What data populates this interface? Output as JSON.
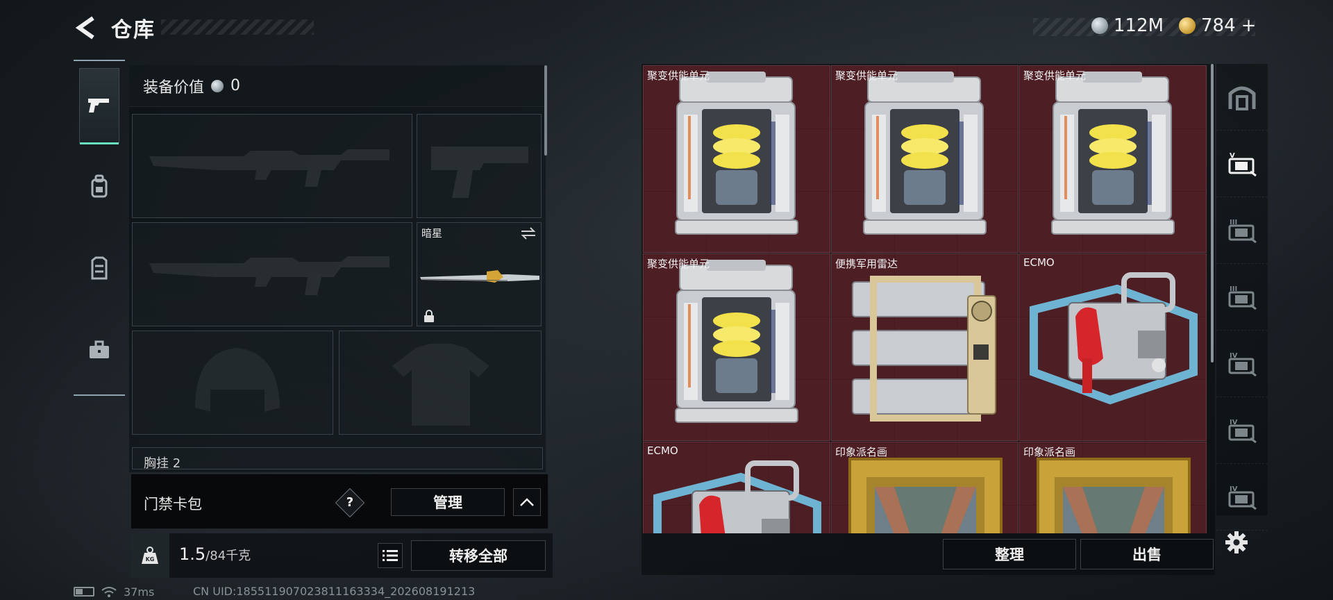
{
  "header": {
    "title": "仓库",
    "currency_silver": "112M",
    "currency_gold": "784",
    "add_symbol": "+"
  },
  "left_tabs": [
    {
      "icon": "pistol-icon",
      "active": true
    },
    {
      "icon": "backpack-icon",
      "active": false
    },
    {
      "icon": "vest-icon",
      "active": false
    },
    {
      "icon": "briefcase-icon",
      "active": false
    }
  ],
  "equipment": {
    "value_label": "装备价值",
    "value": "0",
    "melee_slot_name": "暗星",
    "chest_rig_label": "胸挂 2"
  },
  "keycard": {
    "label": "门禁卡包",
    "help": "?",
    "manage_label": "管理"
  },
  "weight": {
    "current": "1.5",
    "max": "/84千克",
    "transfer_all_label": "转移全部",
    "kg_label": "KG"
  },
  "status": {
    "ping": "37ms",
    "uid": "CN UID:185511907023811163334_202608191213"
  },
  "storage": {
    "items": [
      {
        "name": "聚变供能单元",
        "type": "fusion"
      },
      {
        "name": "聚变供能单元",
        "type": "fusion"
      },
      {
        "name": "聚变供能单元",
        "type": "fusion"
      },
      {
        "name": "聚变供能单元",
        "type": "fusion"
      },
      {
        "name": "便携军用雷达",
        "type": "radar"
      },
      {
        "name": "ECMO",
        "type": "ecmo"
      },
      {
        "name": "ECMO",
        "type": "ecmo"
      },
      {
        "name": "印象派名画",
        "type": "painting"
      },
      {
        "name": "印象派名画",
        "type": "painting"
      }
    ],
    "sort_label": "整理",
    "sell_label": "出售",
    "cell_color": "#4d1e24"
  },
  "right_tabs": [
    {
      "icon": "vault-icon",
      "badge": ""
    },
    {
      "icon": "storage-case-icon",
      "badge": "V"
    },
    {
      "icon": "storage-case-icon",
      "badge": "III"
    },
    {
      "icon": "storage-case-icon",
      "badge": "III"
    },
    {
      "icon": "storage-case-icon",
      "badge": "IV"
    },
    {
      "icon": "storage-case-icon",
      "badge": "IV"
    },
    {
      "icon": "storage-case-icon",
      "badge": "IV"
    }
  ],
  "colors": {
    "accent": "#67e0c0",
    "item_bg": "#4d1e24"
  }
}
